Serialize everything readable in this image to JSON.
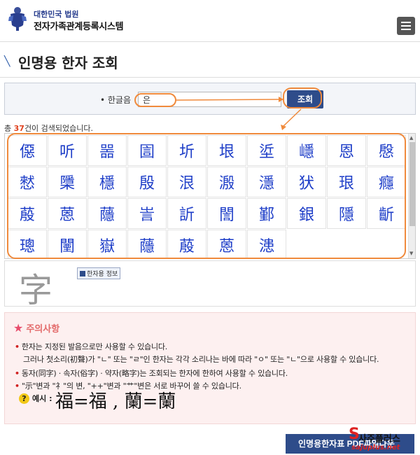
{
  "header": {
    "court_name": "대한민국 법원",
    "system_name": "전자가족관계등록시스템",
    "menu_icon": "hamburger-menu-icon"
  },
  "page": {
    "title": "인명용 한자 조회"
  },
  "search": {
    "label": "• 한글음",
    "value": "은",
    "button_label": "조회"
  },
  "results": {
    "prefix": "총 ",
    "count": "37",
    "suffix": "건이 검색되었습니다.",
    "characters": [
      "僫",
      "听",
      "噐",
      "圁",
      "圻",
      "垠",
      "垽",
      "嶾",
      "恩",
      "慇",
      "憖",
      "檃",
      "檼",
      "殷",
      "泿",
      "溵",
      "濦",
      "犾",
      "珢",
      "癮",
      "蒑",
      "蒽",
      "蘟",
      "訔",
      "訢",
      "誾",
      "鄞",
      "銀",
      "隱",
      "齗",
      "璁",
      "闉",
      "嶽",
      "蘟",
      "蒑",
      "蒽",
      "漶"
    ]
  },
  "preview": {
    "character": "字",
    "info_label": "한자용 정보"
  },
  "caution": {
    "heading": "주의사항",
    "lines": [
      "한자는 지정된 발음으로만 사용할 수 있습니다.",
      "그러나 첫소리(初聲)가 \"ㄴ\" 또는 \"ㄹ\"인 한자는 각각 소리나는 바에 따라 \"ㅇ\" 또는 \"ㄴ\"으로 사용할 수 있습니다.",
      "동자(同字) · 속자(俗字) · 약자(略字)는 조회되는 한자에 한하여 사용할 수 있습니다.",
      "\"示\"변과 \"礻\"의 변, \"++\"변과 \"艹\"변은 서로 바꾸어 쓸 수 있습니다."
    ],
    "example_label": "예시 :",
    "example_text": "福=福 , 蘭=蘭"
  },
  "footer": {
    "pdf_button_label": "인명용한자표 PDF파일다운",
    "watermark_brand": "사주플러스",
    "watermark_url": "sajuplus.net"
  },
  "colors": {
    "accent": "#2e4c8a",
    "hanja_blue": "#1e3ec8",
    "count_red": "#e0421f",
    "highlight_orange": "#f08a3c",
    "caution_bg": "#fdf0f0"
  }
}
